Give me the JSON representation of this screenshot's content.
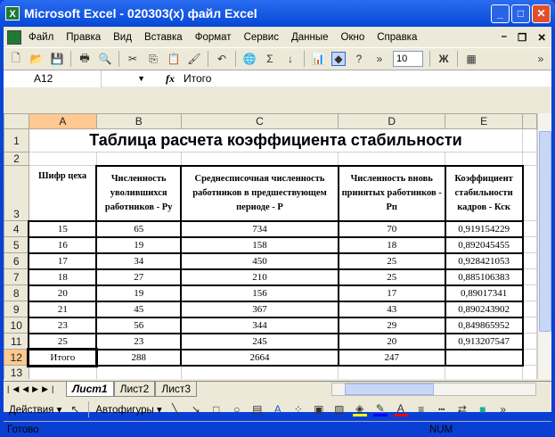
{
  "window": {
    "title": "Microsoft Excel - 020303(x) файл Excel"
  },
  "menu": [
    "Файл",
    "Правка",
    "Вид",
    "Вставка",
    "Формат",
    "Сервис",
    "Данные",
    "Окно",
    "Справка"
  ],
  "toolbar": {
    "font_size": "10",
    "bold_label": "Ж"
  },
  "formula": {
    "cell_ref": "A12",
    "fx": "fx",
    "value": "Итого"
  },
  "columns": [
    "A",
    "B",
    "C",
    "D",
    "E"
  ],
  "sheet": {
    "title": "Таблица расчета коэффициента стабильности",
    "headers": [
      "Шифр цеха",
      "Численность уволившихся работников - Ру",
      "Среднесписочная численность работников в предшествующем периоде - Р",
      "Численность вновь принятых работников - Рп",
      "Коэффициент стабильности кадров - Кск"
    ],
    "rows": [
      [
        "15",
        "65",
        "734",
        "70",
        "0,919154229"
      ],
      [
        "16",
        "19",
        "158",
        "18",
        "0,892045455"
      ],
      [
        "17",
        "34",
        "450",
        "25",
        "0,928421053"
      ],
      [
        "18",
        "27",
        "210",
        "25",
        "0,885106383"
      ],
      [
        "20",
        "19",
        "156",
        "17",
        "0,89017341"
      ],
      [
        "21",
        "45",
        "367",
        "43",
        "0,890243902"
      ],
      [
        "23",
        "56",
        "344",
        "29",
        "0,849865952"
      ],
      [
        "25",
        "23",
        "245",
        "20",
        "0,913207547"
      ]
    ],
    "total": [
      "Итого",
      "288",
      "2664",
      "247",
      ""
    ]
  },
  "tabs": [
    "Лист1",
    "Лист2",
    "Лист3"
  ],
  "drawing": {
    "actions": "Действия ▾",
    "autoshapes": "Автофигуры ▾"
  },
  "status": {
    "ready": "Готово",
    "num": "NUM"
  }
}
